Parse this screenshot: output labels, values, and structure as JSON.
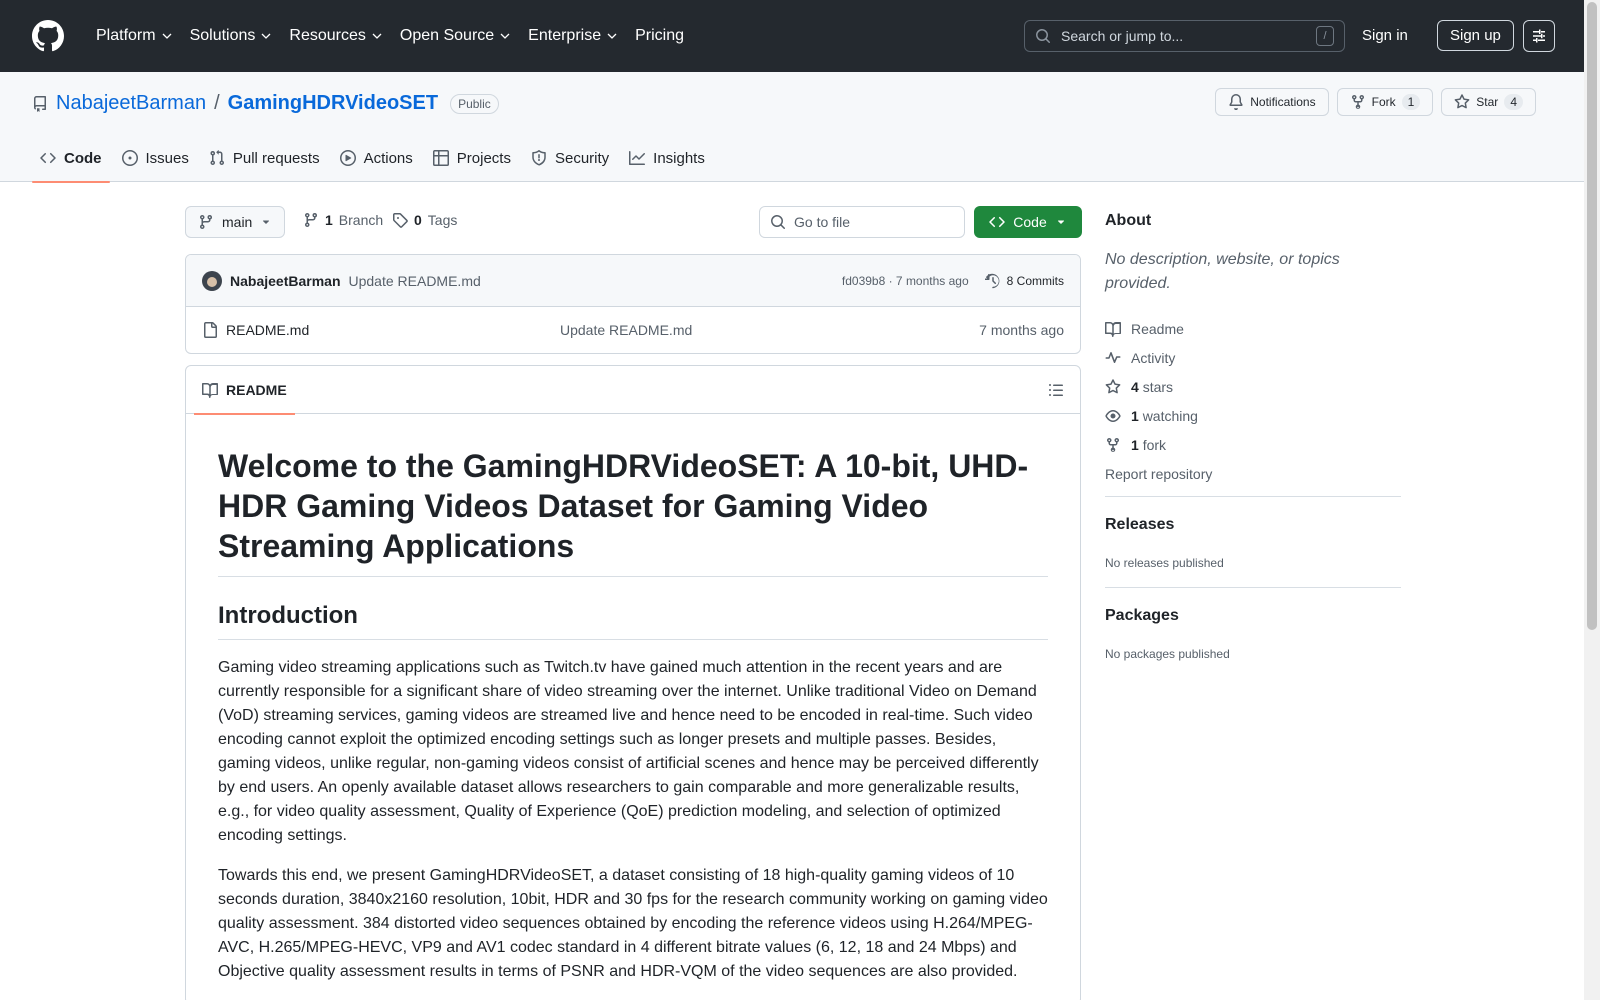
{
  "header": {
    "nav": [
      "Platform",
      "Solutions",
      "Resources",
      "Open Source",
      "Enterprise",
      "Pricing"
    ],
    "search_placeholder": "Search or jump to...",
    "search_shortcut": "/",
    "signin": "Sign in",
    "signup": "Sign up"
  },
  "repo": {
    "owner": "NabajeetBarman",
    "separator": "/",
    "name": "GamingHDRVideoSET",
    "visibility": "Public",
    "notifications": "Notifications",
    "fork_label": "Fork",
    "fork_count": "1",
    "star_label": "Star",
    "star_count": "4",
    "tabs": [
      "Code",
      "Issues",
      "Pull requests",
      "Actions",
      "Projects",
      "Security",
      "Insights"
    ]
  },
  "toolbar": {
    "branch": "main",
    "branch_count": "1",
    "branch_label": "Branch",
    "tag_count": "0",
    "tag_label": "Tags",
    "goto_placeholder": "Go to file",
    "code_button": "Code"
  },
  "commit": {
    "author": "NabajeetBarman",
    "message": "Update README.md",
    "hash_time": "fd039b8 · 7 months ago",
    "commits": "8 Commits"
  },
  "files": [
    {
      "name": "README.md",
      "message": "Update README.md",
      "time": "7 months ago"
    }
  ],
  "readme": {
    "tab": "README",
    "h1": "Welcome to the GamingHDRVideoSET: A 10-bit, UHD-HDR Gaming Videos Dataset for Gaming Video Streaming Applications",
    "h2": "Introduction",
    "p1": "Gaming video streaming applications such as Twitch.tv have gained much attention in the recent years and are currently responsible for a significant share of video streaming over the internet. Unlike traditional Video on Demand (VoD) streaming services, gaming videos are streamed live and hence need to be encoded in real-time. Such video encoding cannot exploit the optimized encoding settings such as longer presets and multiple passes. Besides, gaming videos, unlike regular, non-gaming videos consist of artificial scenes and hence may be perceived differently by end users. An openly available dataset allows researchers to gain comparable and more generalizable results, e.g., for video quality assessment, Quality of Experience (QoE) prediction modeling, and selection of optimized encoding settings.",
    "p2": "Towards this end, we present GamingHDRVideoSET, a dataset consisting of 18 high-quality gaming videos of 10 seconds duration, 3840x2160 resolution, 10bit, HDR and 30 fps for the research community working on gaming video quality assessment. 384 distorted video sequences obtained by encoding the reference videos using H.264/MPEG-AVC, H.265/MPEG-HEVC, VP9 and AV1 codec standard in 4 different bitrate values (6, 12, 18 and 24 Mbps) and Objective quality assessment results in terms of PSNR and HDR-VQM of the video sequences are also provided."
  },
  "sidebar": {
    "about_title": "About",
    "about_desc": "No description, website, or topics provided.",
    "readme": "Readme",
    "activity": "Activity",
    "stars_count": "4",
    "stars_label": "stars",
    "watching_count": "1",
    "watching_label": "watching",
    "fork_count": "1",
    "fork_label": "fork",
    "report": "Report repository",
    "releases_title": "Releases",
    "releases_desc": "No releases published",
    "packages_title": "Packages",
    "packages_desc": "No packages published"
  }
}
